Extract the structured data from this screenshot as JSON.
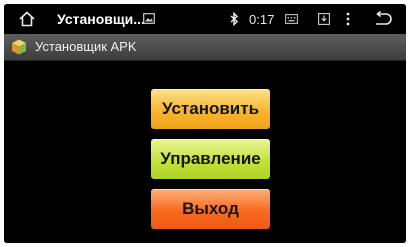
{
  "status_bar": {
    "title": "Установщи...",
    "time": "0:17"
  },
  "app_bar": {
    "title": "Установщик APK"
  },
  "buttons": {
    "install": "Установить",
    "manage": "Управление",
    "exit": "Выход"
  },
  "colors": {
    "install_button": "#f7b52f",
    "manage_button": "#c3e23a",
    "exit_button": "#f76a1f",
    "app_bar": "#4d4d4d",
    "background": "#000000"
  }
}
